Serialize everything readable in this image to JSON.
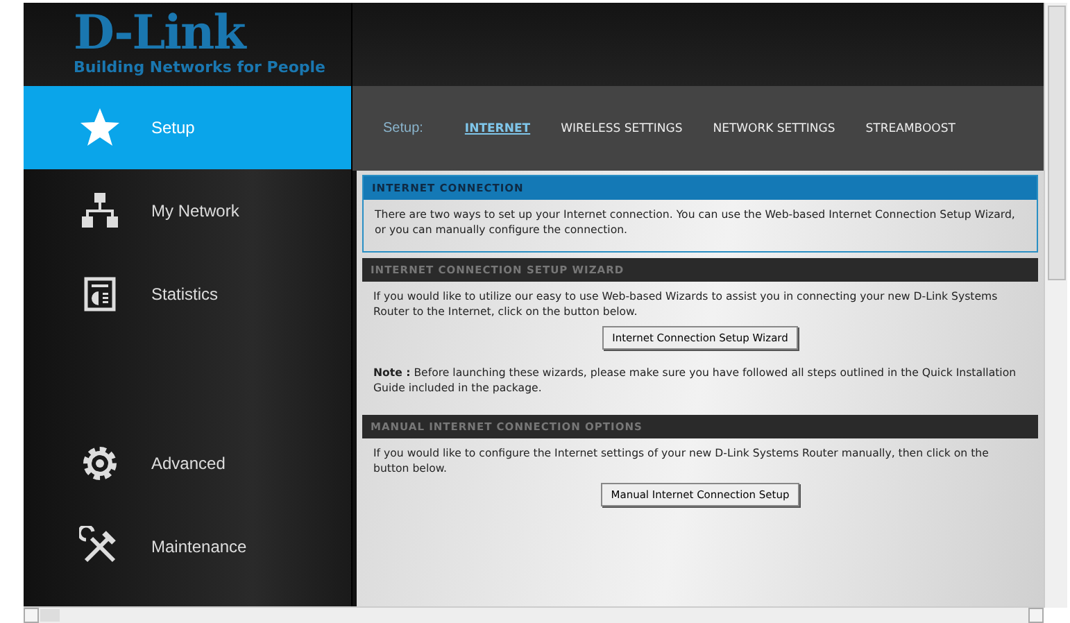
{
  "logo": {
    "brand": "D-Link",
    "tagline": "Building Networks for People"
  },
  "sidebar": {
    "items": [
      {
        "label": "Setup",
        "kind": "star",
        "selected": true
      },
      {
        "label": "My Network",
        "kind": "network",
        "selected": false
      },
      {
        "label": "Statistics",
        "kind": "statistics",
        "selected": false
      },
      {
        "label": "Advanced",
        "kind": "gear",
        "selected": false
      },
      {
        "label": "Maintenance",
        "kind": "tools",
        "selected": false
      }
    ]
  },
  "tabs": {
    "label": "Setup:",
    "items": [
      {
        "label": "INTERNET",
        "selected": true
      },
      {
        "label": "WIRELESS SETTINGS",
        "selected": false
      },
      {
        "label": "NETWORK SETTINGS",
        "selected": false
      },
      {
        "label": "STREAMBOOST",
        "selected": false
      }
    ]
  },
  "sections": [
    {
      "kind": "highlight",
      "title": "INTERNET CONNECTION",
      "paragraphs": [
        "There are two ways to set up your Internet connection. You can use the Web-based Internet Connection Setup Wizard, or you can manually configure the connection."
      ]
    },
    {
      "kind": "plain",
      "title": "INTERNET CONNECTION SETUP WIZARD",
      "paragraphs": [
        "If you would like to utilize our easy to use Web-based Wizards to assist you in connecting your new D-Link Systems Router to the Internet, click on the button below."
      ],
      "button": "Internet Connection Setup Wizard",
      "note": "**Note :** Before launching these wizards, please make sure you have followed all steps outlined in the Quick Installation Guide included in the package."
    },
    {
      "kind": "plain",
      "title": "MANUAL INTERNET CONNECTION OPTIONS",
      "paragraphs": [
        "If you would like to configure the Internet settings of your new D-Link Systems Router manually, then click on the button below."
      ],
      "button": "Manual Internet Connection Setup"
    }
  ]
}
